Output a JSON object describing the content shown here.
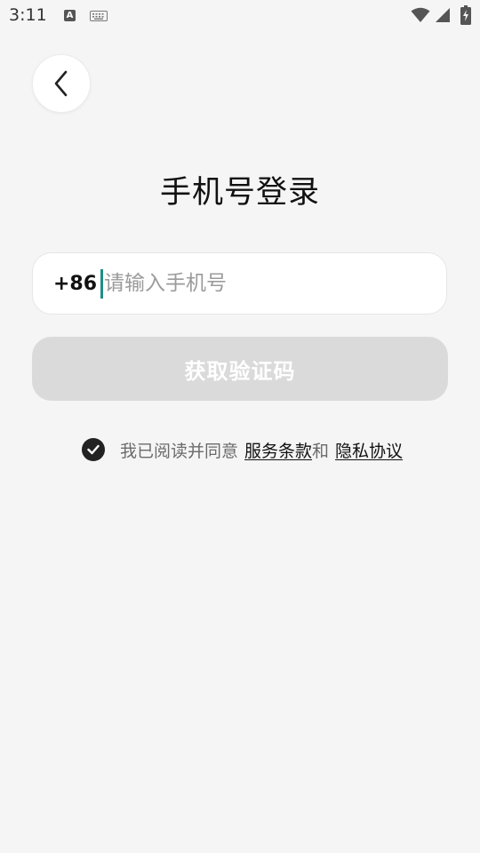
{
  "status_bar": {
    "time": "3:11",
    "notification_badge": "A"
  },
  "header": {
    "title": "手机号登录"
  },
  "phone_form": {
    "country_code": "+86",
    "phone_value": "",
    "phone_placeholder": "请输入手机号",
    "get_code_label": "获取验证码"
  },
  "agreement": {
    "checked": true,
    "prefix": "我已阅读并同意",
    "terms_label": "服务条款",
    "conjunction": "和",
    "privacy_label": "隐私协议"
  },
  "colors": {
    "background": "#f5f5f5",
    "button_disabled": "#dadada",
    "cursor_accent": "#1f8f85",
    "checkbox_fill": "#222222"
  }
}
